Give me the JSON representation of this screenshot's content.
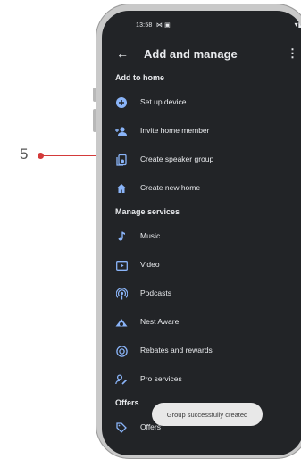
{
  "callout": {
    "label": "5"
  },
  "status_bar": {
    "time": "13:58",
    "right": "▾▮"
  },
  "header": {
    "title": "Add and manage",
    "back_icon": "arrow-left-icon",
    "more_icon": "more-vert-icon"
  },
  "sections": {
    "add_to_home": {
      "title": "Add to home",
      "items": [
        {
          "label": "Set up device",
          "icon": "add-circle-icon"
        },
        {
          "label": "Invite home member",
          "icon": "person-add-icon"
        },
        {
          "label": "Create speaker group",
          "icon": "speaker-group-icon"
        },
        {
          "label": "Create new home",
          "icon": "home-icon"
        }
      ]
    },
    "manage_services": {
      "title": "Manage services",
      "items": [
        {
          "label": "Music",
          "icon": "music-note-icon"
        },
        {
          "label": "Video",
          "icon": "video-icon"
        },
        {
          "label": "Podcasts",
          "icon": "podcasts-icon"
        },
        {
          "label": "Nest Aware",
          "icon": "nest-aware-icon"
        },
        {
          "label": "Rebates and rewards",
          "icon": "rebates-icon"
        },
        {
          "label": "Pro services",
          "icon": "pro-services-icon"
        }
      ]
    },
    "offers": {
      "title": "Offers",
      "items": [
        {
          "label": "Offers",
          "icon": "tag-icon"
        }
      ]
    }
  },
  "toast": {
    "text": "Group successfully created"
  },
  "colors": {
    "screen_bg": "#222427",
    "accent": "#8ab4f8",
    "callout": "#d33a3a"
  }
}
